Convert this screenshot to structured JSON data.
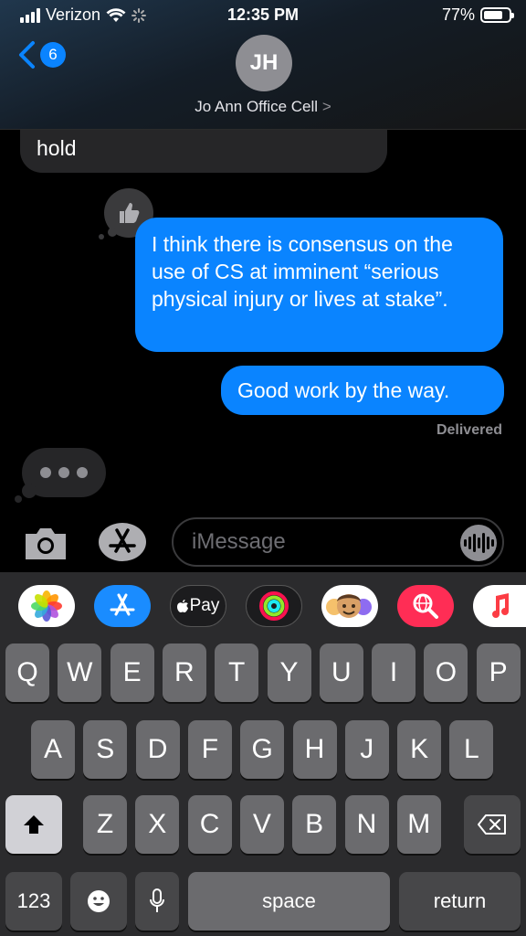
{
  "status_bar": {
    "carrier": "Verizon",
    "time": "12:35 PM",
    "battery": "77%",
    "battery_level": 0.77
  },
  "header": {
    "back_count": "6",
    "avatar_initials": "JH",
    "contact_name": "Jo Ann Office Cell",
    "contact_arrow": ">"
  },
  "messages": [
    {
      "direction": "incoming",
      "text": "hold"
    },
    {
      "direction": "outgoing",
      "text": "I think there is consensus on the use of CS at imminent “serious physical injury or lives at stake”.",
      "tapback": "thumbs-up"
    },
    {
      "direction": "outgoing",
      "text": "Good work by the way."
    }
  ],
  "delivered_label": "Delivered",
  "input": {
    "placeholder": "iMessage"
  },
  "app_strip": [
    {
      "name": "photos-app-icon",
      "bg": "#ffffff"
    },
    {
      "name": "app-store-icon",
      "bg": "#1a8cff"
    },
    {
      "name": "apple-pay-icon",
      "bg": "#1c1c1e",
      "label": "Pay"
    },
    {
      "name": "activity-icon",
      "bg": "#1c1c1e"
    },
    {
      "name": "memoji-icon",
      "bg": "#ffffff"
    },
    {
      "name": "search-images-icon",
      "bg": "#ff2d55"
    },
    {
      "name": "music-icon",
      "bg": "#ffffff"
    }
  ],
  "keyboard": {
    "row1": [
      "Q",
      "W",
      "E",
      "R",
      "T",
      "Y",
      "U",
      "I",
      "O",
      "P"
    ],
    "row2": [
      "A",
      "S",
      "D",
      "F",
      "G",
      "H",
      "J",
      "K",
      "L"
    ],
    "row3": [
      "Z",
      "X",
      "C",
      "V",
      "B",
      "N",
      "M"
    ],
    "numbers_label": "123",
    "space_label": "space",
    "return_label": "return"
  },
  "colors": {
    "outgoing_bubble": "#0a84ff",
    "incoming_bubble": "#262628",
    "key": "#6b6b6e",
    "key_dark": "#474749"
  }
}
